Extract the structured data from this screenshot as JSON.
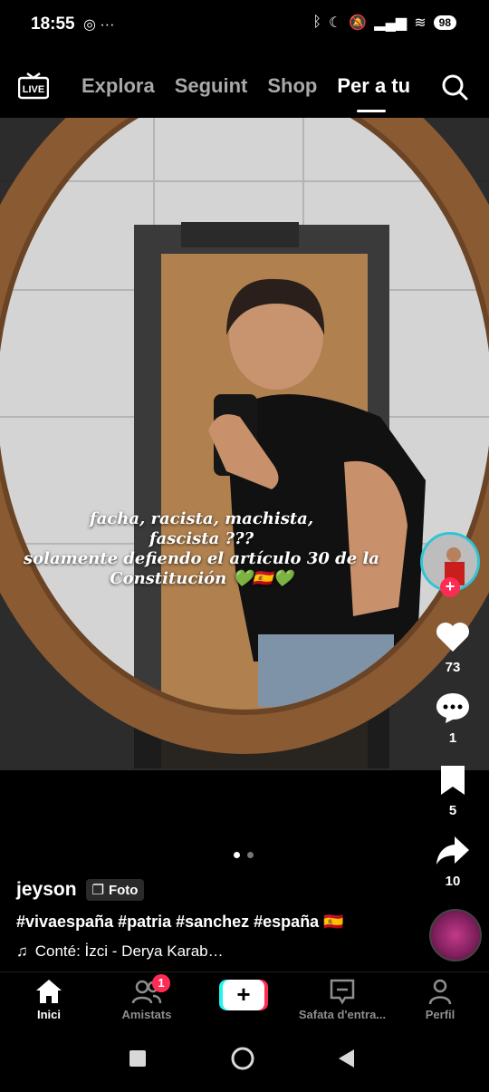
{
  "status_bar": {
    "time": "18:55",
    "battery": "98"
  },
  "top_nav": {
    "tabs": [
      {
        "label": "Explora",
        "active": false
      },
      {
        "label": "Seguint",
        "active": false
      },
      {
        "label": "Shop",
        "active": false
      },
      {
        "label": "Per a tu",
        "active": true
      }
    ],
    "live_label": "LIVE"
  },
  "post": {
    "overlay_lines": [
      "facha, racista, machista,",
      "fascista ???",
      "solamente defiendo el artículo 30 de la",
      "Constitución 💚🇪🇸💚"
    ],
    "author": "jeyson",
    "type_badge": "Foto",
    "hashtags": "#vivaespaña #patria #sanchez #españa 🇪🇸",
    "music": "Conté: İzci - Derya Karab…",
    "photo_count": 2,
    "active_photo": 1
  },
  "actions": {
    "likes": "73",
    "comments": "1",
    "saves": "5",
    "shares": "10"
  },
  "bottom_nav": {
    "home": "Inici",
    "friends": "Amistats",
    "friends_badge": "1",
    "create": "+",
    "inbox": "Safata d'entra...",
    "profile": "Perfil"
  },
  "colors": {
    "accent": "#fe2c55",
    "cyan": "#25f4ee"
  }
}
